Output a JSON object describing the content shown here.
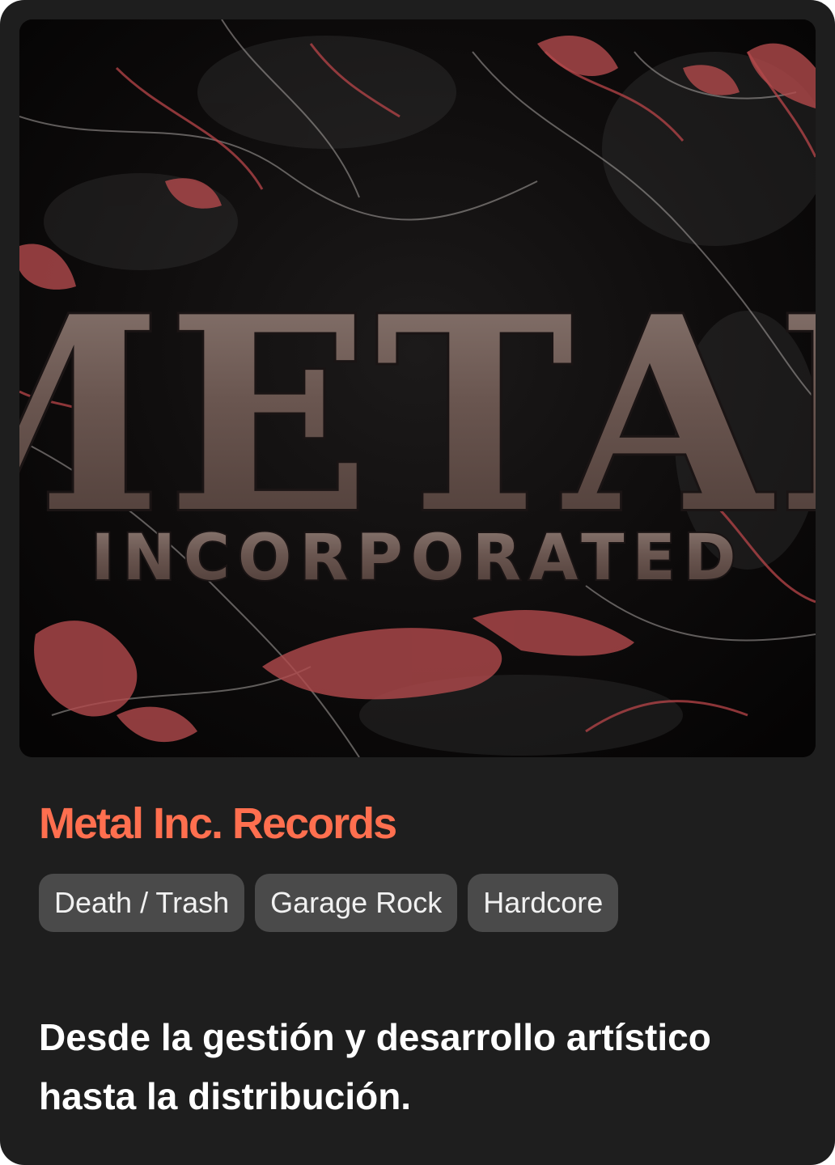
{
  "card": {
    "image": {
      "logo_line1": "METAL",
      "logo_line2": "INCORPORATED"
    },
    "title": "Metal Inc. Records",
    "title_color": "#ff6f4f",
    "tags": [
      {
        "label": "Death / Trash"
      },
      {
        "label": "Garage Rock"
      },
      {
        "label": "Hardcore"
      }
    ],
    "description": "Desde la gestión y desarrollo artístico hasta la distribución."
  }
}
